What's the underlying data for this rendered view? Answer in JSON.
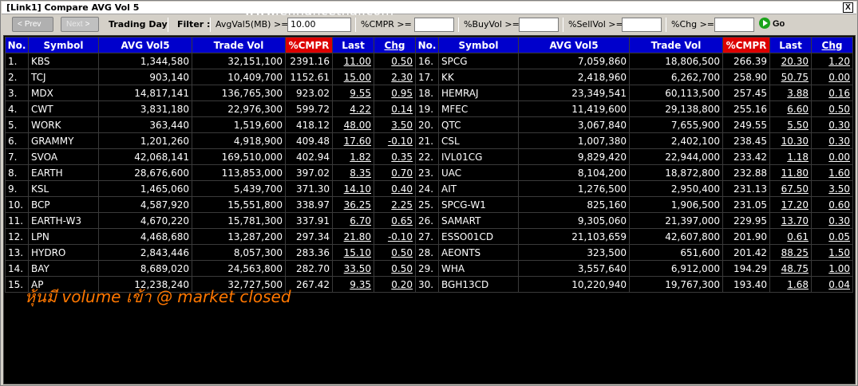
{
  "window": {
    "title": "[Link1] Compare AVG Vol 5",
    "close_label": "X"
  },
  "watermark": "www.efinancethai.com",
  "toolbar": {
    "prev_label": "Prev",
    "next_label": "Next",
    "trading_day": "Trading Day",
    "filter_label": "Filter :",
    "avgvol_label": "AvgVal5(MB) >=",
    "avgvol_value": "10.00",
    "cmpr_label": "%CMPR >=",
    "cmpr_value": "",
    "buyvol_label": "%BuyVol >=",
    "buyvol_value": "",
    "sellvol_label": "%SellVol >=",
    "sellvol_value": "",
    "chg_label": "%Chg >=",
    "chg_value": "",
    "go_label": "Go"
  },
  "headers": [
    "No.",
    "Symbol",
    "AVG Vol5",
    "Trade Vol",
    "%CMPR",
    "Last",
    "Chg"
  ],
  "colors": {
    "up": "#00ee00",
    "down": "#ff2020",
    "flat": "#ffff00",
    "header": "#0000cc",
    "cmpr_header": "#dd0000"
  },
  "left_rows": [
    {
      "no": "1.",
      "sym": "KBS",
      "avg": "1,344,580",
      "trade": "32,151,100",
      "cmpr": "2391.16",
      "last": "11.00",
      "chg": "0.50",
      "dir": "up"
    },
    {
      "no": "2.",
      "sym": "TCJ",
      "avg": "903,140",
      "trade": "10,409,700",
      "cmpr": "1152.61",
      "last": "15.00",
      "chg": "2.30",
      "dir": "up"
    },
    {
      "no": "3.",
      "sym": "MDX",
      "avg": "14,817,141",
      "trade": "136,765,300",
      "cmpr": "923.02",
      "last": "9.55",
      "chg": "0.95",
      "dir": "up"
    },
    {
      "no": "4.",
      "sym": "CWT",
      "avg": "3,831,180",
      "trade": "22,976,300",
      "cmpr": "599.72",
      "last": "4.22",
      "chg": "0.14",
      "dir": "up"
    },
    {
      "no": "5.",
      "sym": "WORK",
      "avg": "363,440",
      "trade": "1,519,600",
      "cmpr": "418.12",
      "last": "48.00",
      "chg": "3.50",
      "dir": "up"
    },
    {
      "no": "6.",
      "sym": "GRAMMY",
      "avg": "1,201,260",
      "trade": "4,918,900",
      "cmpr": "409.48",
      "last": "17.60",
      "chg": "-0.10",
      "dir": "down"
    },
    {
      "no": "7.",
      "sym": "SVOA",
      "avg": "42,068,141",
      "trade": "169,510,000",
      "cmpr": "402.94",
      "last": "1.82",
      "chg": "0.35",
      "dir": "up"
    },
    {
      "no": "8.",
      "sym": "EARTH",
      "avg": "28,676,600",
      "trade": "113,853,000",
      "cmpr": "397.02",
      "last": "8.35",
      "chg": "0.70",
      "dir": "up"
    },
    {
      "no": "9.",
      "sym": "KSL",
      "avg": "1,465,060",
      "trade": "5,439,700",
      "cmpr": "371.30",
      "last": "14.10",
      "chg": "0.40",
      "dir": "up"
    },
    {
      "no": "10.",
      "sym": "BCP",
      "avg": "4,587,920",
      "trade": "15,551,800",
      "cmpr": "338.97",
      "last": "36.25",
      "chg": "2.25",
      "dir": "up"
    },
    {
      "no": "11.",
      "sym": "EARTH-W3",
      "avg": "4,670,220",
      "trade": "15,781,300",
      "cmpr": "337.91",
      "last": "6.70",
      "chg": "0.65",
      "dir": "up"
    },
    {
      "no": "12.",
      "sym": "LPN",
      "avg": "4,468,680",
      "trade": "13,287,200",
      "cmpr": "297.34",
      "last": "21.80",
      "chg": "-0.10",
      "dir": "down"
    },
    {
      "no": "13.",
      "sym": "HYDRO",
      "avg": "2,843,446",
      "trade": "8,057,300",
      "cmpr": "283.36",
      "last": "15.10",
      "chg": "0.50",
      "dir": "up"
    },
    {
      "no": "14.",
      "sym": "BAY",
      "avg": "8,689,020",
      "trade": "24,563,800",
      "cmpr": "282.70",
      "last": "33.50",
      "chg": "0.50",
      "dir": "up"
    },
    {
      "no": "15.",
      "sym": "AP",
      "avg": "12,238,240",
      "trade": "32,727,500",
      "cmpr": "267.42",
      "last": "9.35",
      "chg": "0.20",
      "dir": "up"
    }
  ],
  "right_rows": [
    {
      "no": "16.",
      "sym": "SPCG",
      "avg": "7,059,860",
      "trade": "18,806,500",
      "cmpr": "266.39",
      "last": "20.30",
      "chg": "1.20",
      "dir": "up"
    },
    {
      "no": "17.",
      "sym": "KK",
      "avg": "2,418,960",
      "trade": "6,262,700",
      "cmpr": "258.90",
      "last": "50.75",
      "chg": "0.00",
      "dir": "flat"
    },
    {
      "no": "18.",
      "sym": "HEMRAJ",
      "avg": "23,349,541",
      "trade": "60,113,500",
      "cmpr": "257.45",
      "last": "3.88",
      "chg": "0.16",
      "dir": "up"
    },
    {
      "no": "19.",
      "sym": "MFEC",
      "avg": "11,419,600",
      "trade": "29,138,800",
      "cmpr": "255.16",
      "last": "6.60",
      "chg": "0.50",
      "dir": "up"
    },
    {
      "no": "20.",
      "sym": "QTC",
      "avg": "3,067,840",
      "trade": "7,655,900",
      "cmpr": "249.55",
      "last": "5.50",
      "chg": "0.30",
      "dir": "up"
    },
    {
      "no": "21.",
      "sym": "CSL",
      "avg": "1,007,380",
      "trade": "2,402,100",
      "cmpr": "238.45",
      "last": "10.30",
      "chg": "0.30",
      "dir": "up"
    },
    {
      "no": "22.",
      "sym": "IVL01CG",
      "avg": "9,829,420",
      "trade": "22,944,000",
      "cmpr": "233.42",
      "last": "1.18",
      "chg": "0.00",
      "dir": "flat"
    },
    {
      "no": "23.",
      "sym": "UAC",
      "avg": "8,104,200",
      "trade": "18,872,800",
      "cmpr": "232.88",
      "last": "11.80",
      "chg": "1.60",
      "dir": "up"
    },
    {
      "no": "24.",
      "sym": "AIT",
      "avg": "1,276,500",
      "trade": "2,950,400",
      "cmpr": "231.13",
      "last": "67.50",
      "chg": "3.50",
      "dir": "up"
    },
    {
      "no": "25.",
      "sym": "SPCG-W1",
      "avg": "825,160",
      "trade": "1,906,500",
      "cmpr": "231.05",
      "last": "17.20",
      "chg": "0.60",
      "dir": "up"
    },
    {
      "no": "26.",
      "sym": "SAMART",
      "avg": "9,305,060",
      "trade": "21,397,000",
      "cmpr": "229.95",
      "last": "13.70",
      "chg": "0.30",
      "dir": "up"
    },
    {
      "no": "27.",
      "sym": "ESSO01CD",
      "avg": "21,103,659",
      "trade": "42,607,800",
      "cmpr": "201.90",
      "last": "0.61",
      "chg": "0.05",
      "dir": "up"
    },
    {
      "no": "28.",
      "sym": "AEONTS",
      "avg": "323,500",
      "trade": "651,600",
      "cmpr": "201.42",
      "last": "88.25",
      "chg": "1.50",
      "dir": "up"
    },
    {
      "no": "29.",
      "sym": "WHA",
      "avg": "3,557,640",
      "trade": "6,912,000",
      "cmpr": "194.29",
      "last": "48.75",
      "chg": "1.00",
      "dir": "up"
    },
    {
      "no": "30.",
      "sym": "BGH13CD",
      "avg": "10,220,940",
      "trade": "19,767,300",
      "cmpr": "193.40",
      "last": "1.68",
      "chg": "0.04",
      "dir": "up"
    }
  ],
  "note": "หุ้นมี volume เข้า @ market closed"
}
